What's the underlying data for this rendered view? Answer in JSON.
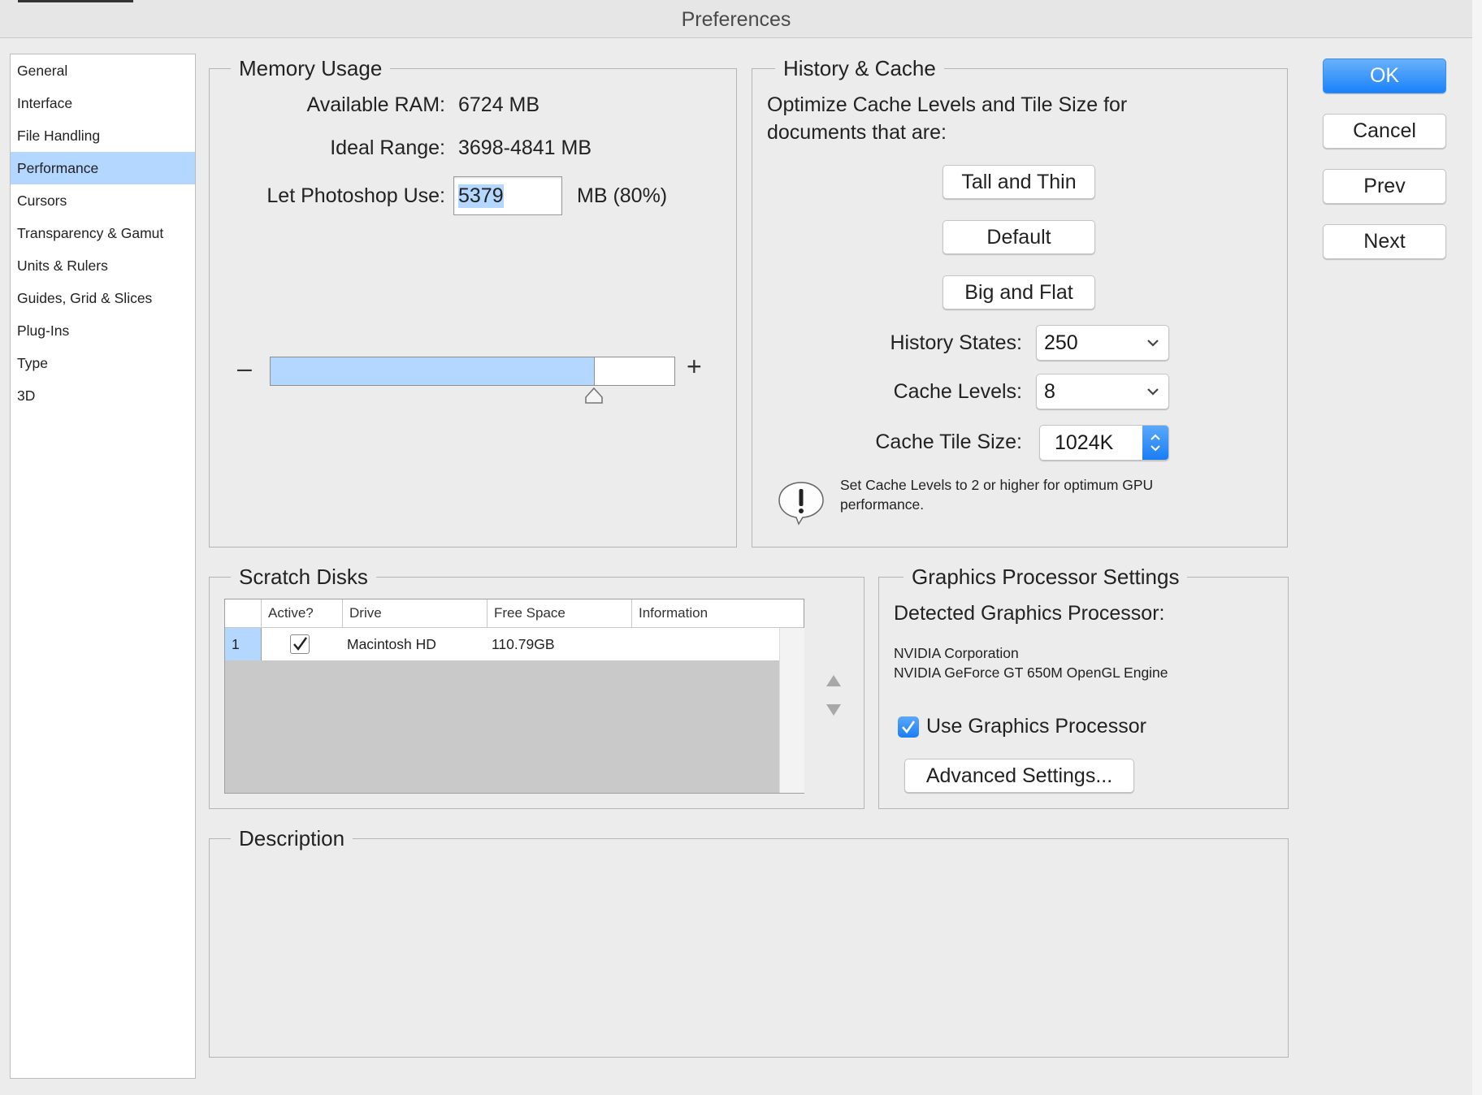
{
  "window": {
    "title": "Preferences"
  },
  "sidebar": {
    "items": [
      {
        "label": "General"
      },
      {
        "label": "Interface"
      },
      {
        "label": "File Handling"
      },
      {
        "label": "Performance",
        "selected": true
      },
      {
        "label": "Cursors"
      },
      {
        "label": "Transparency & Gamut"
      },
      {
        "label": "Units & Rulers"
      },
      {
        "label": "Guides, Grid & Slices"
      },
      {
        "label": "Plug-Ins"
      },
      {
        "label": "Type"
      },
      {
        "label": "3D"
      }
    ]
  },
  "memory": {
    "legend": "Memory Usage",
    "available_label": "Available RAM:",
    "available_value": "6724 MB",
    "ideal_label": "Ideal Range:",
    "ideal_value": "3698-4841 MB",
    "use_label": "Let Photoshop Use:",
    "use_value": "5379",
    "use_suffix": "MB (80%)",
    "minus": "–",
    "plus": "+",
    "slider_fraction": 0.8
  },
  "history": {
    "legend": "History & Cache",
    "optimize_line1": "Optimize Cache Levels and Tile Size for",
    "optimize_line2": "documents that are:",
    "btn_tall": "Tall and Thin",
    "btn_default": "Default",
    "btn_big": "Big and Flat",
    "states_label": "History States:",
    "states_value": "250",
    "levels_label": "Cache Levels:",
    "levels_value": "8",
    "tile_label": "Cache Tile Size:",
    "tile_value": "1024K",
    "warning_line1": "Set Cache Levels to 2 or higher for optimum GPU",
    "warning_line2": "performance."
  },
  "scratch": {
    "legend": "Scratch Disks",
    "columns": [
      "Active?",
      "Drive",
      "Free Space",
      "Information"
    ],
    "rows": [
      {
        "num": "1",
        "active": true,
        "drive": "Macintosh HD",
        "free": "110.79GB",
        "info": ""
      }
    ]
  },
  "gpu": {
    "legend": "Graphics Processor Settings",
    "detected_label": "Detected Graphics Processor:",
    "vendor": "NVIDIA Corporation",
    "model": "NVIDIA GeForce GT 650M OpenGL Engine",
    "use_label": "Use Graphics Processor",
    "use_checked": true,
    "advanced_label": "Advanced Settings..."
  },
  "description": {
    "legend": "Description"
  },
  "actions": {
    "ok": "OK",
    "cancel": "Cancel",
    "prev": "Prev",
    "next": "Next"
  },
  "colors": {
    "accent": "#1a82fb",
    "selection": "#b3d7ff",
    "background": "#ececec"
  }
}
